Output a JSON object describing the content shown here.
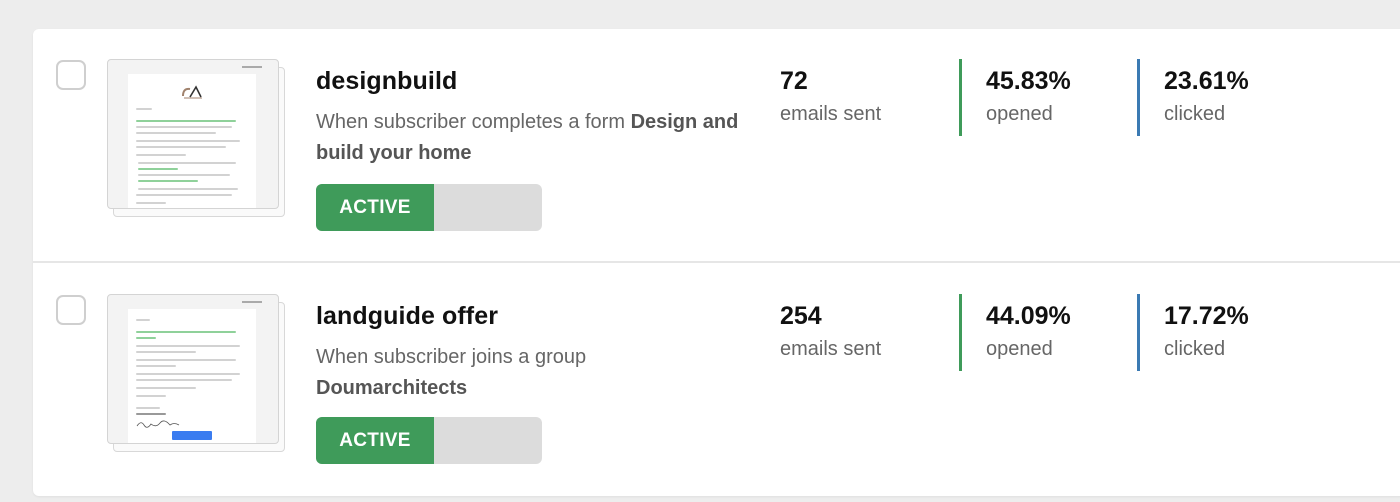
{
  "campaigns": [
    {
      "name": "designbuild",
      "trigger_prefix": "When subscriber completes a form ",
      "trigger_target": "Design and build your home",
      "status": "ACTIVE",
      "emails_sent": "72",
      "emails_sent_label": "emails sent",
      "opened": "45.83%",
      "opened_label": "opened",
      "clicked": "23.61%",
      "clicked_label": "clicked"
    },
    {
      "name": "landguide offer",
      "trigger_prefix": "When subscriber joins a group ",
      "trigger_target": "Doumarchitects",
      "status": "ACTIVE",
      "emails_sent": "254",
      "emails_sent_label": "emails sent",
      "opened": "44.09%",
      "opened_label": "opened",
      "clicked": "17.72%",
      "clicked_label": "clicked"
    }
  ],
  "colors": {
    "active": "#3f9b5a",
    "opened_bar": "#3f9b5a",
    "clicked_bar": "#3b7ab3"
  }
}
